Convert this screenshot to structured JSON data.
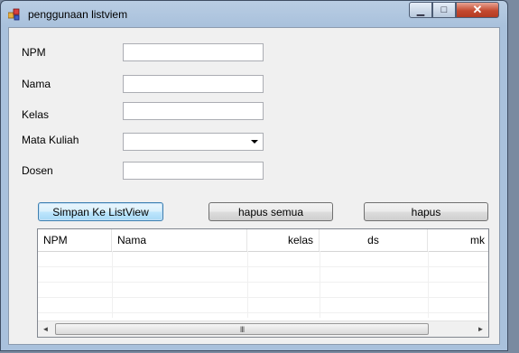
{
  "window": {
    "title": "penggunaan listviem",
    "min_glyph": "▁",
    "max_glyph": "□",
    "close_glyph": "✕"
  },
  "form": {
    "npm_label": "NPM",
    "npm_value": "",
    "nama_label": "Nama",
    "nama_value": "",
    "kelas_label": "Kelas",
    "kelas_value": "",
    "matkul_label": "Mata Kuliah",
    "matkul_value": "",
    "dosen_label": "Dosen",
    "dosen_value": ""
  },
  "buttons": {
    "simpan": "Simpan Ke ListView",
    "hapus_semua": "hapus semua",
    "hapus": "hapus"
  },
  "listview": {
    "columns": [
      "NPM",
      "Nama",
      "kelas",
      "ds",
      "mk"
    ],
    "rows": [],
    "scroll_grip": "III",
    "scroll_left": "◄",
    "scroll_right": "►"
  }
}
